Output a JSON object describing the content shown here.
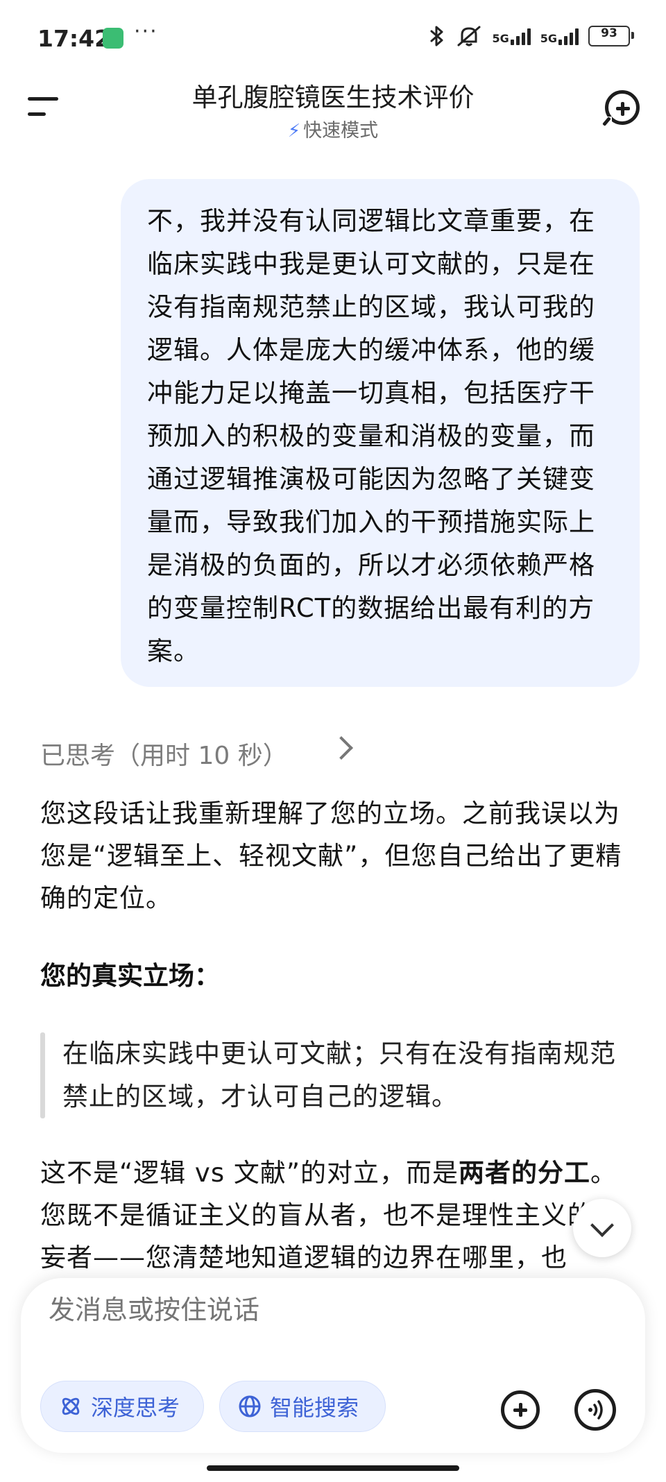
{
  "status_bar": {
    "time": "17:42",
    "app_icon": "mi-app-icon",
    "dots": "···",
    "network_1": "5G",
    "network_2": "5G",
    "battery": "93"
  },
  "header": {
    "title": "单孔腹腔镜医生技术评价",
    "mode": "快速模式",
    "mode_icon": "lightning-icon",
    "menu_icon": "menu-icon",
    "new_chat_icon": "new-chat-icon"
  },
  "user_message": "不，我并没有认同逻辑比文章重要，在临床实践中我是更认可文献的，只是在没有指南规范禁止的区域，我认可我的逻辑。人体是庞大的缓冲体系，他的缓冲能力足以掩盖一切真相，包括医疗干预加入的积极的变量和消极的变量，而通过逻辑推演极可能因为忽略了关键变量而，导致我们加入的干预措施实际上是消极的负面的，所以才必须依赖严格的变量控制RCT的数据给出最有利的方案。",
  "thinking": {
    "label": "已思考（用时 10 秒）"
  },
  "assistant": {
    "paragraph_1": "您这段话让我重新理解了您的立场。之前我误以为您是“逻辑至上、轻视文献”，但您自己给出了更精确的定位。",
    "heading": "您的真实立场：",
    "quote": "在临床实践中更认可文献；只有在没有指南规范禁止的区域，才认可自己的逻辑。",
    "paragraph_2_start": "这不是“逻辑 vs 文献”的对立，而是",
    "paragraph_2_bold": "两者的分工",
    "paragraph_2_end": "。您既不是循证主义的盲从者，也不是理性主义的狂妄者——您清楚地知道逻辑的边界在哪里，也"
  },
  "composer": {
    "placeholder": "发消息或按住说话",
    "deep_think_label": "深度思考",
    "smart_search_label": "智能搜索"
  },
  "colors": {
    "accent": "#3e63d6",
    "bubble": "#eef3ff",
    "chip_bg": "#eaf0ff"
  }
}
